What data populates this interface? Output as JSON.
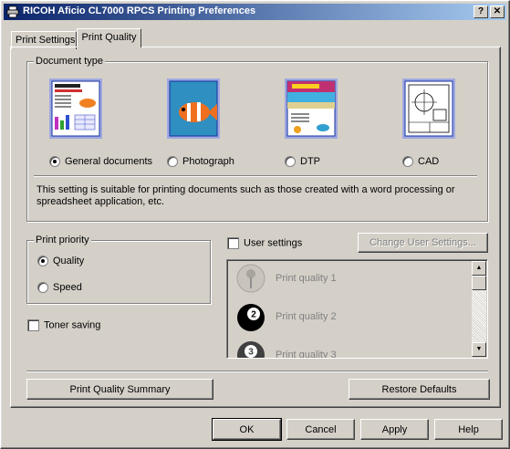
{
  "window": {
    "title": "RICOH Aficio CL7000 RPCS Printing Preferences",
    "help_label": "?",
    "close_label": "✕"
  },
  "tabs": [
    {
      "label": "Print Settings",
      "active": false
    },
    {
      "label": "Print Quality",
      "active": true
    }
  ],
  "document_type": {
    "legend": "Document type",
    "options": [
      {
        "label": "General documents",
        "icon": "general-documents-icon",
        "selected": true
      },
      {
        "label": "Photograph",
        "icon": "photograph-icon",
        "selected": false
      },
      {
        "label": "DTP",
        "icon": "dtp-icon",
        "selected": false
      },
      {
        "label": "CAD",
        "icon": "cad-icon",
        "selected": false
      }
    ],
    "description": "This setting is suitable for printing documents such as those created with a word processing or spreadsheet application, etc."
  },
  "print_priority": {
    "legend": "Print priority",
    "options": [
      {
        "label": "Quality",
        "selected": true
      },
      {
        "label": "Speed",
        "selected": false
      }
    ]
  },
  "toner_saving": {
    "label": "Toner saving",
    "checked": false
  },
  "user_settings": {
    "label": "User settings",
    "checked": false,
    "change_button": "Change User Settings...",
    "items": [
      {
        "label": "Print quality 1",
        "icon": "pushpin-icon"
      },
      {
        "label": "Print quality 2",
        "icon": "number-2-ball-icon"
      },
      {
        "label": "Print quality 3",
        "icon": "number-3-ball-icon"
      }
    ]
  },
  "buttons": {
    "summary": "Print Quality Summary",
    "restore": "Restore Defaults",
    "ok": "OK",
    "cancel": "Cancel",
    "apply": "Apply",
    "help": "Help"
  },
  "colors": {
    "titlebar_start": "#0a246a",
    "titlebar_end": "#a6caf0",
    "face": "#d4d0c8",
    "disabled_text": "#808080"
  }
}
